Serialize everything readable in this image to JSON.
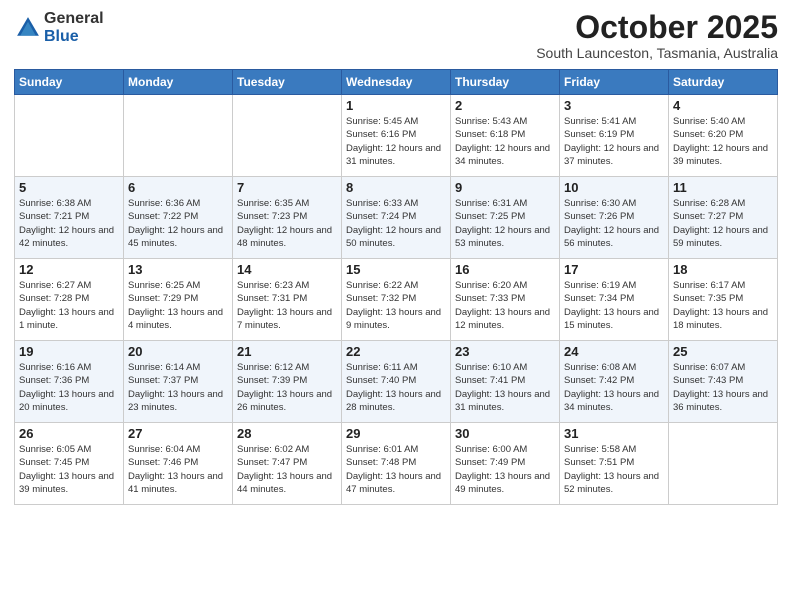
{
  "logo": {
    "general": "General",
    "blue": "Blue"
  },
  "header": {
    "month": "October 2025",
    "location": "South Launceston, Tasmania, Australia"
  },
  "weekdays": [
    "Sunday",
    "Monday",
    "Tuesday",
    "Wednesday",
    "Thursday",
    "Friday",
    "Saturday"
  ],
  "weeks": [
    [
      {
        "day": "",
        "sunrise": "",
        "sunset": "",
        "daylight": ""
      },
      {
        "day": "",
        "sunrise": "",
        "sunset": "",
        "daylight": ""
      },
      {
        "day": "",
        "sunrise": "",
        "sunset": "",
        "daylight": ""
      },
      {
        "day": "1",
        "sunrise": "Sunrise: 5:45 AM",
        "sunset": "Sunset: 6:16 PM",
        "daylight": "Daylight: 12 hours and 31 minutes."
      },
      {
        "day": "2",
        "sunrise": "Sunrise: 5:43 AM",
        "sunset": "Sunset: 6:18 PM",
        "daylight": "Daylight: 12 hours and 34 minutes."
      },
      {
        "day": "3",
        "sunrise": "Sunrise: 5:41 AM",
        "sunset": "Sunset: 6:19 PM",
        "daylight": "Daylight: 12 hours and 37 minutes."
      },
      {
        "day": "4",
        "sunrise": "Sunrise: 5:40 AM",
        "sunset": "Sunset: 6:20 PM",
        "daylight": "Daylight: 12 hours and 39 minutes."
      }
    ],
    [
      {
        "day": "5",
        "sunrise": "Sunrise: 6:38 AM",
        "sunset": "Sunset: 7:21 PM",
        "daylight": "Daylight: 12 hours and 42 minutes."
      },
      {
        "day": "6",
        "sunrise": "Sunrise: 6:36 AM",
        "sunset": "Sunset: 7:22 PM",
        "daylight": "Daylight: 12 hours and 45 minutes."
      },
      {
        "day": "7",
        "sunrise": "Sunrise: 6:35 AM",
        "sunset": "Sunset: 7:23 PM",
        "daylight": "Daylight: 12 hours and 48 minutes."
      },
      {
        "day": "8",
        "sunrise": "Sunrise: 6:33 AM",
        "sunset": "Sunset: 7:24 PM",
        "daylight": "Daylight: 12 hours and 50 minutes."
      },
      {
        "day": "9",
        "sunrise": "Sunrise: 6:31 AM",
        "sunset": "Sunset: 7:25 PM",
        "daylight": "Daylight: 12 hours and 53 minutes."
      },
      {
        "day": "10",
        "sunrise": "Sunrise: 6:30 AM",
        "sunset": "Sunset: 7:26 PM",
        "daylight": "Daylight: 12 hours and 56 minutes."
      },
      {
        "day": "11",
        "sunrise": "Sunrise: 6:28 AM",
        "sunset": "Sunset: 7:27 PM",
        "daylight": "Daylight: 12 hours and 59 minutes."
      }
    ],
    [
      {
        "day": "12",
        "sunrise": "Sunrise: 6:27 AM",
        "sunset": "Sunset: 7:28 PM",
        "daylight": "Daylight: 13 hours and 1 minute."
      },
      {
        "day": "13",
        "sunrise": "Sunrise: 6:25 AM",
        "sunset": "Sunset: 7:29 PM",
        "daylight": "Daylight: 13 hours and 4 minutes."
      },
      {
        "day": "14",
        "sunrise": "Sunrise: 6:23 AM",
        "sunset": "Sunset: 7:31 PM",
        "daylight": "Daylight: 13 hours and 7 minutes."
      },
      {
        "day": "15",
        "sunrise": "Sunrise: 6:22 AM",
        "sunset": "Sunset: 7:32 PM",
        "daylight": "Daylight: 13 hours and 9 minutes."
      },
      {
        "day": "16",
        "sunrise": "Sunrise: 6:20 AM",
        "sunset": "Sunset: 7:33 PM",
        "daylight": "Daylight: 13 hours and 12 minutes."
      },
      {
        "day": "17",
        "sunrise": "Sunrise: 6:19 AM",
        "sunset": "Sunset: 7:34 PM",
        "daylight": "Daylight: 13 hours and 15 minutes."
      },
      {
        "day": "18",
        "sunrise": "Sunrise: 6:17 AM",
        "sunset": "Sunset: 7:35 PM",
        "daylight": "Daylight: 13 hours and 18 minutes."
      }
    ],
    [
      {
        "day": "19",
        "sunrise": "Sunrise: 6:16 AM",
        "sunset": "Sunset: 7:36 PM",
        "daylight": "Daylight: 13 hours and 20 minutes."
      },
      {
        "day": "20",
        "sunrise": "Sunrise: 6:14 AM",
        "sunset": "Sunset: 7:37 PM",
        "daylight": "Daylight: 13 hours and 23 minutes."
      },
      {
        "day": "21",
        "sunrise": "Sunrise: 6:12 AM",
        "sunset": "Sunset: 7:39 PM",
        "daylight": "Daylight: 13 hours and 26 minutes."
      },
      {
        "day": "22",
        "sunrise": "Sunrise: 6:11 AM",
        "sunset": "Sunset: 7:40 PM",
        "daylight": "Daylight: 13 hours and 28 minutes."
      },
      {
        "day": "23",
        "sunrise": "Sunrise: 6:10 AM",
        "sunset": "Sunset: 7:41 PM",
        "daylight": "Daylight: 13 hours and 31 minutes."
      },
      {
        "day": "24",
        "sunrise": "Sunrise: 6:08 AM",
        "sunset": "Sunset: 7:42 PM",
        "daylight": "Daylight: 13 hours and 34 minutes."
      },
      {
        "day": "25",
        "sunrise": "Sunrise: 6:07 AM",
        "sunset": "Sunset: 7:43 PM",
        "daylight": "Daylight: 13 hours and 36 minutes."
      }
    ],
    [
      {
        "day": "26",
        "sunrise": "Sunrise: 6:05 AM",
        "sunset": "Sunset: 7:45 PM",
        "daylight": "Daylight: 13 hours and 39 minutes."
      },
      {
        "day": "27",
        "sunrise": "Sunrise: 6:04 AM",
        "sunset": "Sunset: 7:46 PM",
        "daylight": "Daylight: 13 hours and 41 minutes."
      },
      {
        "day": "28",
        "sunrise": "Sunrise: 6:02 AM",
        "sunset": "Sunset: 7:47 PM",
        "daylight": "Daylight: 13 hours and 44 minutes."
      },
      {
        "day": "29",
        "sunrise": "Sunrise: 6:01 AM",
        "sunset": "Sunset: 7:48 PM",
        "daylight": "Daylight: 13 hours and 47 minutes."
      },
      {
        "day": "30",
        "sunrise": "Sunrise: 6:00 AM",
        "sunset": "Sunset: 7:49 PM",
        "daylight": "Daylight: 13 hours and 49 minutes."
      },
      {
        "day": "31",
        "sunrise": "Sunrise: 5:58 AM",
        "sunset": "Sunset: 7:51 PM",
        "daylight": "Daylight: 13 hours and 52 minutes."
      },
      {
        "day": "",
        "sunrise": "",
        "sunset": "",
        "daylight": ""
      }
    ]
  ]
}
